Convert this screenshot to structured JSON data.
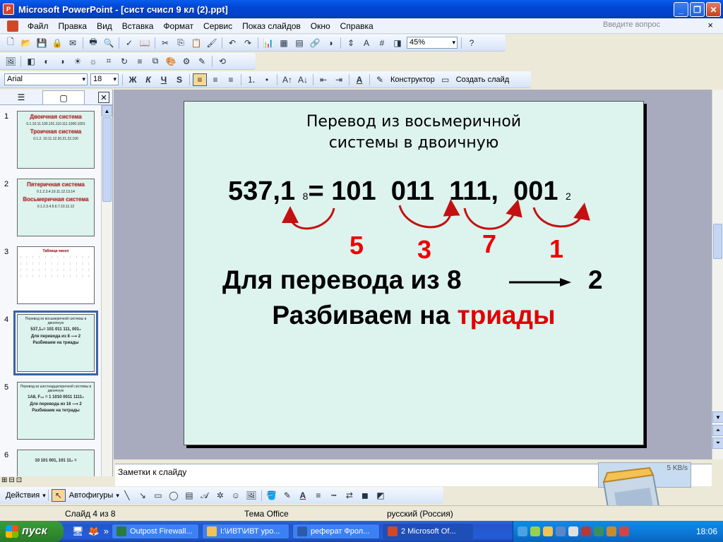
{
  "window": {
    "title": "Microsoft PowerPoint - [сист счисл 9 кл (2).ppt]",
    "buttons": [
      "_",
      "❐",
      "✕"
    ]
  },
  "menu": {
    "items": [
      "Файл",
      "Правка",
      "Вид",
      "Вставка",
      "Формат",
      "Сервис",
      "Показ слайдов",
      "Окно",
      "Справка"
    ],
    "ask_placeholder": "Введите вопрос",
    "close": "×"
  },
  "toolbar_standard": {
    "zoom": "45%"
  },
  "toolbar_format": {
    "font": "Arial",
    "size": "18",
    "bold": "Ж",
    "italic": "К",
    "underline": "Ч",
    "shadow": "S",
    "designer": "Конструктор",
    "new_slide": "Создать слайд"
  },
  "slides": [
    {
      "num": "1",
      "title_a": "Двоичная система",
      "line_a": "0.1.10.11.100.101.110.111.1000.1001",
      "title_b": "Троичная система",
      "line_b": "0.1.2. 10.11.12.20.21.22.100"
    },
    {
      "num": "2",
      "title_a": "Пятеричная система",
      "line_a": "0.1.2.3.4.10.11.12.13.14",
      "title_b": "Восьмеричная система",
      "line_b": "0.1.2.3.4.5.6.7.10.11.12"
    },
    {
      "num": "3",
      "title_a": "Таблица чисел",
      "line_a": "",
      "title_b": "",
      "line_b": ""
    },
    {
      "num": "4",
      "title_a": "Перевод из восьмеричной системы в двоичную",
      "line_a": "537,1₈= 101 011 111, 001₂",
      "title_b": "Для перевода из 8 ⟶ 2",
      "line_b": "Разбиваем на триады"
    },
    {
      "num": "5",
      "title_a": "Перевод из шестнадцатеричной системы в двоичную",
      "line_a": "1A8, F₁₆ = 1 1010 0011 1111₂",
      "title_b": "Для перевода из 16 ⟶ 2",
      "line_b": "Разбиваем на тетрады"
    },
    {
      "num": "6",
      "title_a": "",
      "line_a": "10 101 001, 101 11₂ =",
      "title_b": "",
      "line_b": ""
    }
  ],
  "current_slide": {
    "heading_line1": "Перевод из восьмеричной",
    "heading_line2": "системы в  двоичную",
    "number": "537,1",
    "base_from": "8",
    "equals": "=",
    "groups": [
      "101",
      "011",
      "111,",
      "001"
    ],
    "base_to": "2",
    "digits": [
      "5",
      "3",
      "7",
      "1"
    ],
    "rule_text": "Для перевода из 8",
    "rule_target": "2",
    "split_text": "Разбиваем на ",
    "split_highlight": "триады",
    "accent_color": "#E00000",
    "arc_color": "#C41010",
    "background": "#DDF3EE"
  },
  "notes": {
    "placeholder": "Заметки к слайду"
  },
  "net_widget": {
    "speed": "5 KB/s"
  },
  "drawing_toolbar": {
    "actions": "Действия",
    "autoshapes": "Автофигуры"
  },
  "status": {
    "slide": "Слайд 4 из 8",
    "theme": "Тема Office",
    "language": "русский (Россия)"
  },
  "taskbar": {
    "start": "пуск",
    "tasks": [
      {
        "label": "Outpost Firewall...",
        "active": false
      },
      {
        "label": "I:\\ИВТ\\ИВТ уро...",
        "active": false
      },
      {
        "label": "реферат Фрол...",
        "active": false
      },
      {
        "label": "2 Microsoft Of...",
        "active": true
      }
    ],
    "clock": "18:06"
  }
}
